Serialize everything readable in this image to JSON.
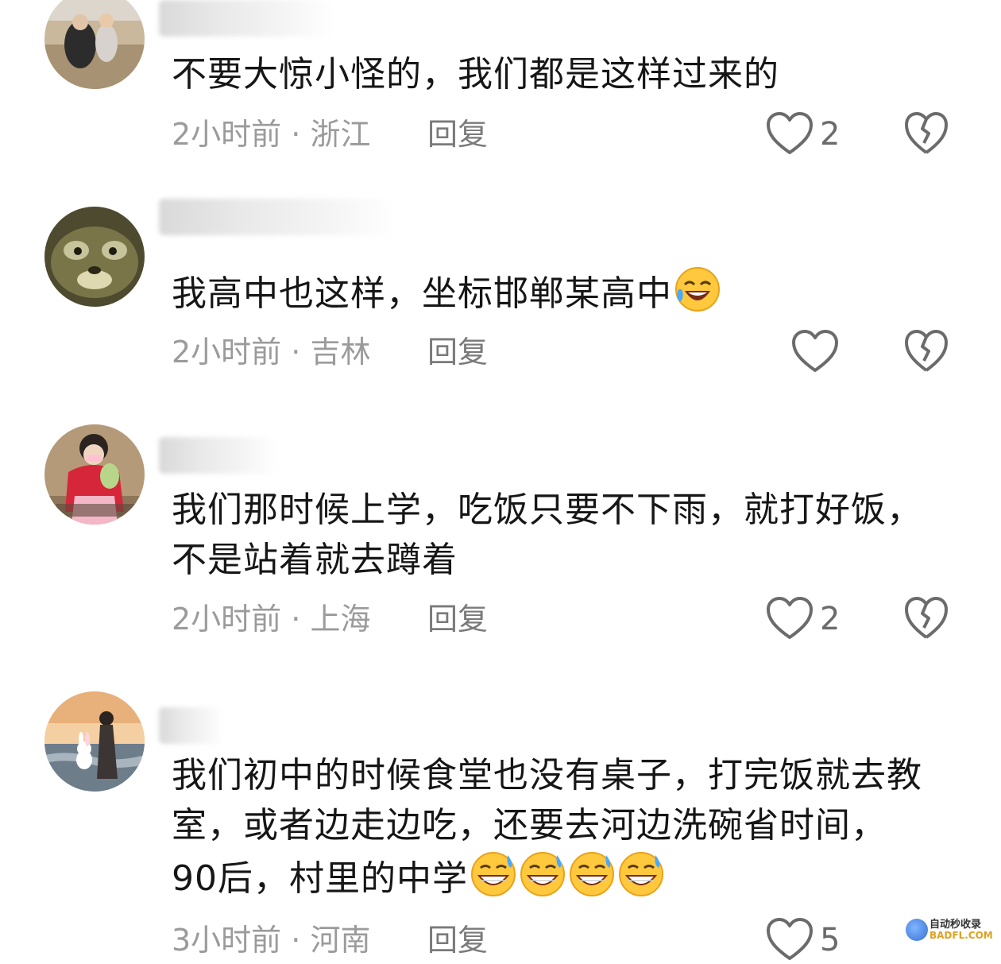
{
  "comments": [
    {
      "text_lines": [
        "不要大惊小怪的，我们都是这样过来的"
      ],
      "time": "2小时前",
      "location": "浙江",
      "reply_label": "回复",
      "likes": "2"
    },
    {
      "text_lines": [
        "我高中也这样，坐标邯郸某高中"
      ],
      "time": "2小时前",
      "location": "吉林",
      "reply_label": "回复",
      "likes": ""
    },
    {
      "text_lines": [
        "我们那时候上学，吃饭只要不下雨，就打好饭，",
        "不是站着就去蹲着"
      ],
      "time": "2小时前",
      "location": "上海",
      "reply_label": "回复",
      "likes": "2"
    },
    {
      "text_lines": [
        "我们初中的时候食堂也没有桌子，打完饭就去教",
        "室，或者边走边吃，还要去河边洗碗省时间，",
        "90后，村里的中学"
      ],
      "time": "3小时前",
      "location": "河南",
      "reply_label": "回复",
      "likes": "5"
    }
  ],
  "separator": " · ",
  "watermark": {
    "top": "自动秒收录",
    "bottom": "BADFL.COM"
  }
}
